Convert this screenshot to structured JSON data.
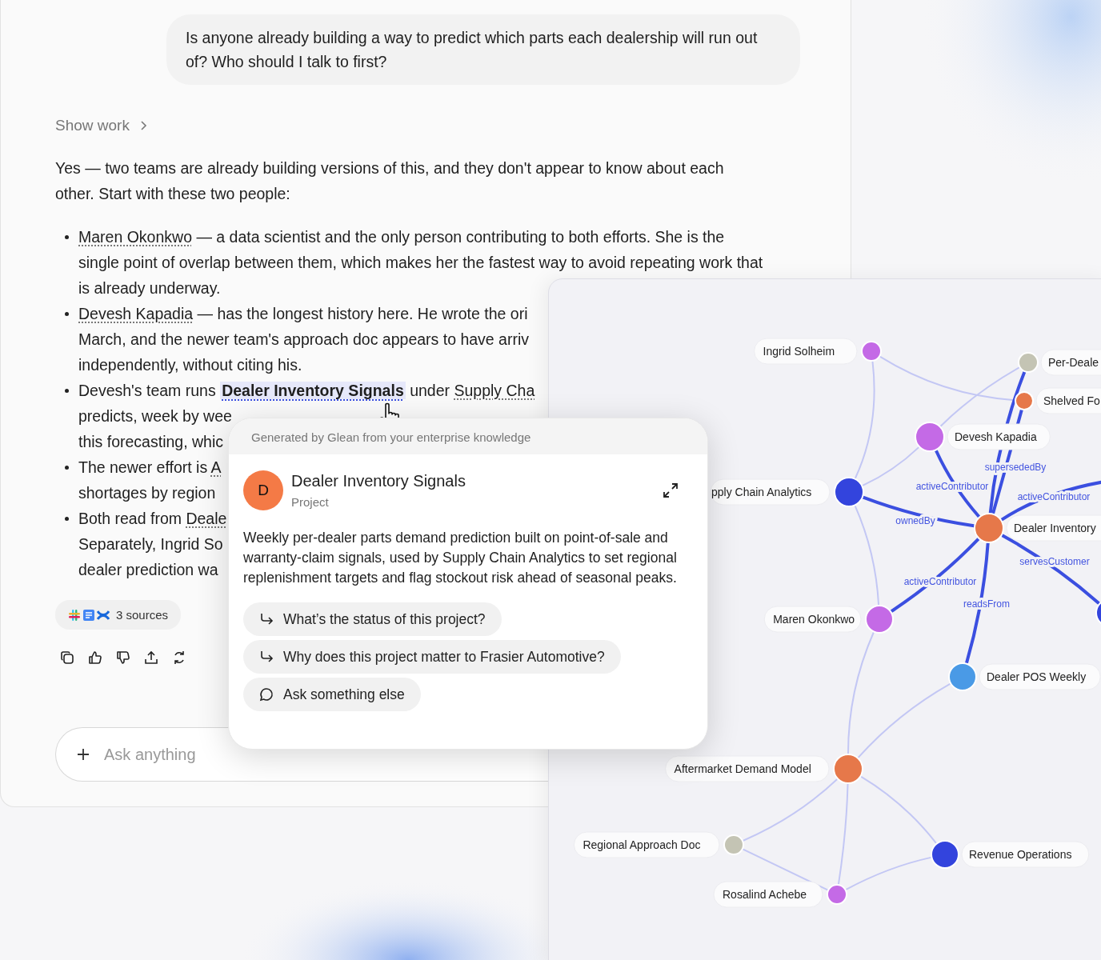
{
  "chat": {
    "user_message": "Is anyone already building a way to predict which parts each dealership will run out of? Who should I talk to first?",
    "show_work": "Show work",
    "answer_intro": [
      "Yes — two teams are already building versions of this, and they don't appear to know about each",
      "other. Start with these two people:"
    ],
    "bullets": [
      {
        "lines": [
          [
            {
              "kind": "link",
              "text": "Maren Okonkwo"
            },
            {
              "kind": "plain",
              "text": " — a data scientist and the only person contributing to both efforts. She is the"
            }
          ],
          [
            {
              "kind": "plain",
              "text": "single point of overlap between them, which makes her the fastest way to avoid repeating work that"
            }
          ],
          [
            {
              "kind": "plain",
              "text": "is already underway."
            }
          ]
        ]
      },
      {
        "lines": [
          [
            {
              "kind": "link",
              "text": "Devesh Kapadia"
            },
            {
              "kind": "plain",
              "text": " — has the longest history here. He wrote the ori"
            }
          ],
          [
            {
              "kind": "plain",
              "text": "March, and the newer team's approach doc appears to have arriv"
            }
          ],
          [
            {
              "kind": "plain",
              "text": "independently, without citing his."
            }
          ]
        ]
      },
      {
        "lines": [
          [
            {
              "kind": "plain",
              "text": "Devesh's team runs "
            },
            {
              "kind": "highlight",
              "text": "Dealer Inventory Signals"
            },
            {
              "kind": "plain",
              "text": " under "
            },
            {
              "kind": "link",
              "text": "Supply Cha"
            }
          ],
          [
            {
              "kind": "plain",
              "text": "predicts, week by wee"
            }
          ],
          [
            {
              "kind": "plain",
              "text": "this forecasting, whic"
            }
          ]
        ]
      },
      {
        "lines": [
          [
            {
              "kind": "plain",
              "text": "The newer effort is "
            },
            {
              "kind": "link",
              "text": "A"
            }
          ],
          [
            {
              "kind": "plain",
              "text": "shortages by region"
            }
          ]
        ]
      },
      {
        "lines": [
          [
            {
              "kind": "plain",
              "text": "Both read from "
            },
            {
              "kind": "link",
              "text": "Deale"
            }
          ],
          [
            {
              "kind": "plain",
              "text": "Separately, Ingrid So"
            }
          ],
          [
            {
              "kind": "plain",
              "text": "dealer prediction wa"
            }
          ]
        ]
      }
    ],
    "sources": {
      "label": "3 sources"
    },
    "composer": {
      "placeholder": "Ask anything"
    }
  },
  "graph": {
    "nodes": [
      {
        "label": "Ingrid Solheim",
        "color": "#c46ae6"
      },
      {
        "label": "Per-Deale",
        "color": "#c4c4b4"
      },
      {
        "label": "Shelved Fo",
        "color": "#e6784a"
      },
      {
        "label": "Devesh Kapadia",
        "color": "#c46ae6"
      },
      {
        "label": "pply Chain Analytics",
        "color": "#3344dd"
      },
      {
        "label": "Dealer Inventory",
        "color": "#e6784a"
      },
      {
        "label": "Maren Okonkwo",
        "color": "#c46ae6"
      },
      {
        "label": "Dealer POS Weekly",
        "color": "#4a9ae6"
      },
      {
        "label": "Aftermarket Demand Model",
        "color": "#e6784a"
      },
      {
        "label": "Regional Approach Doc",
        "color": "#c4c4b4"
      },
      {
        "label": "Revenue Operations",
        "color": "#3344dd"
      },
      {
        "label": "Rosalind Achebe",
        "color": "#c46ae6"
      },
      {
        "color": "#3344dd"
      }
    ],
    "edges": [
      {
        "highlighted": false
      },
      {
        "highlighted": false
      },
      {
        "highlighted": false
      },
      {
        "highlighted": false
      },
      {
        "highlighted": true,
        "label": "supersededBy"
      },
      {
        "highlighted": true
      },
      {
        "highlighted": true,
        "label": "activeContributor"
      },
      {
        "highlighted": true,
        "label": "activeContributor"
      },
      {
        "highlighted": true,
        "label": "ownedBy"
      },
      {
        "highlighted": true,
        "label": "servesCustomer"
      },
      {
        "highlighted": true,
        "label": "activeContributor"
      },
      {
        "highlighted": true,
        "label": "readsFrom"
      },
      {
        "highlighted": false
      },
      {
        "highlighted": false
      },
      {
        "highlighted": false
      },
      {
        "highlighted": false
      },
      {
        "highlighted": false
      },
      {
        "highlighted": false
      },
      {
        "highlighted": false
      },
      {
        "highlighted": false
      }
    ]
  },
  "popup": {
    "header": "Generated by Glean from your enterprise knowledge",
    "avatar": "D",
    "title": "Dealer Inventory Signals",
    "subtitle": "Project",
    "description": "Weekly per-dealer parts demand prediction built on point-of-sale and warranty-claim signals, used by Supply Chain Analytics to set regional replenishment targets and flag stockout risk ahead of seasonal peaks.",
    "suggestions": [
      {
        "kind": "followup",
        "text": "What’s the status of this project?"
      },
      {
        "kind": "followup",
        "text": "Why does this project matter to Frasier Automotive?"
      },
      {
        "kind": "ask",
        "text": "Ask something else"
      }
    ]
  }
}
